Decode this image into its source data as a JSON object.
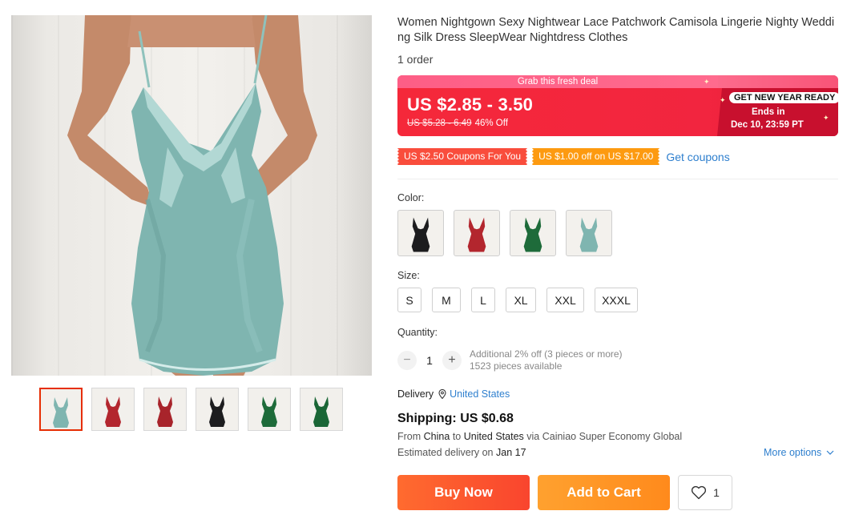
{
  "product": {
    "title": "Women Nightgown Sexy Nightwear Lace Patchwork Camisola Lingerie Nighty Wedding Silk Dress SleepWear Nightdress Clothes",
    "orders": "1 order"
  },
  "gallery": {
    "main_image": "teal-satin-lace-nightdress",
    "thumbnails": [
      {
        "icon": "dress-teal",
        "color": "#7fb5b0"
      },
      {
        "icon": "dress-red",
        "color": "#b3262e"
      },
      {
        "icon": "dress-red",
        "color": "#a8242b"
      },
      {
        "icon": "dress-black",
        "color": "#1c1c1e"
      },
      {
        "icon": "dress-green",
        "color": "#1e6b3a"
      },
      {
        "icon": "dress-green",
        "color": "#1a6636"
      }
    ]
  },
  "deal": {
    "banner": "Grab this fresh deal",
    "price": "US $2.85 - 3.50",
    "original_price": "US $5.28 - 6.49",
    "discount": "46% Off",
    "badge": "GET NEW YEAR READY",
    "ends_label": "Ends in",
    "ends_time": "Dec 10, 23:59 PT"
  },
  "coupons": {
    "coupon1": "US $2.50 Coupons For You",
    "coupon2": "US $1.00 off on US $17.00",
    "get_link": "Get coupons"
  },
  "color": {
    "label": "Color:",
    "options": [
      {
        "name": "black",
        "color": "#1c1c1e"
      },
      {
        "name": "red",
        "color": "#b3262e"
      },
      {
        "name": "green",
        "color": "#1e6b3a"
      },
      {
        "name": "teal",
        "color": "#7fb5b0"
      }
    ]
  },
  "size": {
    "label": "Size:",
    "options": [
      "S",
      "M",
      "L",
      "XL",
      "XXL",
      "XXXL"
    ]
  },
  "quantity": {
    "label": "Quantity:",
    "value": "1",
    "note1": "Additional 2% off (3 pieces or more)",
    "note2": "1523 pieces available"
  },
  "delivery": {
    "label": "Delivery",
    "location": "United States"
  },
  "shipping": {
    "price": "Shipping: US $0.68",
    "from_prefix": "From",
    "from": "China",
    "to_word": "to",
    "to": "United States",
    "via": "via Cainiao Super Economy Global",
    "est_prefix": "Estimated delivery on",
    "est_date": "Jan 17",
    "more_options": "More options"
  },
  "actions": {
    "buy_now": "Buy Now",
    "add_to_cart": "Add to Cart",
    "wishlist_count": "1"
  },
  "colors": {
    "price_red": "#f5283a",
    "banner_pink": "#fd5e86",
    "link_blue": "#2e7fce",
    "buy_orange": "#f9452e",
    "cart_orange": "#ff8a1c"
  }
}
